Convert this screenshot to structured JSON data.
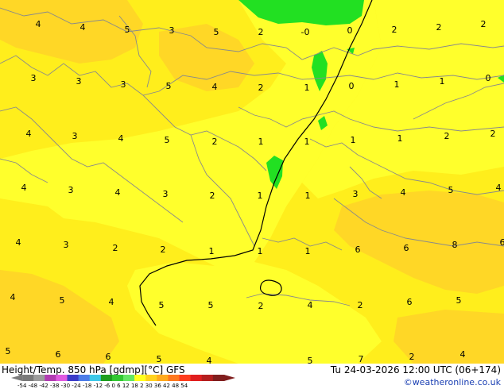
{
  "footer": {
    "title": "Height/Temp. 850 hPa [gdmp][°C] GFS",
    "valid": "Tu 24-03-2026 12:00 UTC (06+174)",
    "credit": "©weatheronline.co.uk",
    "scale_labels": "-54 -48 -42 -38 -30 -24 -18 -12 -6   0   6  12  18  2   30  36  42  48  54",
    "scale_colors": [
      "#7a7a7a",
      "#9c9c9c",
      "#b23cb2",
      "#e05ae0",
      "#3c3cc8",
      "#4c7ce8",
      "#3cc8e8",
      "#1e9e1e",
      "#32c832",
      "#64e664",
      "#ffff1e",
      "#ffd21e",
      "#ffaa1e",
      "#ff781e",
      "#ff3c1e",
      "#e01e1e",
      "#b41e1e",
      "#801e1e"
    ]
  },
  "map": {
    "colors": {
      "warm_yellow": "#fff01e",
      "light_yellow": "#ffff2c",
      "orange_yellow": "#ffd726",
      "green": "#22e022",
      "coast": "#8a8a8a",
      "isotherm": "#000000"
    },
    "labels": [
      {
        "text": "4"
      },
      {
        "text": "4"
      },
      {
        "text": "5"
      },
      {
        "text": "3"
      },
      {
        "text": "5"
      },
      {
        "text": "2"
      },
      {
        "text": "-0"
      },
      {
        "text": "0"
      },
      {
        "text": "2"
      },
      {
        "text": "2"
      },
      {
        "text": "2"
      },
      {
        "text": "3"
      },
      {
        "text": "3"
      },
      {
        "text": "3"
      },
      {
        "text": "5"
      },
      {
        "text": "4"
      },
      {
        "text": "2"
      },
      {
        "text": "1"
      },
      {
        "text": "0"
      },
      {
        "text": "1"
      },
      {
        "text": "1"
      },
      {
        "text": "0"
      },
      {
        "text": "4"
      },
      {
        "text": "3"
      },
      {
        "text": "4"
      },
      {
        "text": "5"
      },
      {
        "text": "2"
      },
      {
        "text": "1"
      },
      {
        "text": "1"
      },
      {
        "text": "1"
      },
      {
        "text": "1"
      },
      {
        "text": "2"
      },
      {
        "text": "2"
      },
      {
        "text": "4"
      },
      {
        "text": "3"
      },
      {
        "text": "4"
      },
      {
        "text": "3"
      },
      {
        "text": "2"
      },
      {
        "text": "1"
      },
      {
        "text": "1"
      },
      {
        "text": "3"
      },
      {
        "text": "4"
      },
      {
        "text": "5"
      },
      {
        "text": "4"
      },
      {
        "text": "4"
      },
      {
        "text": "3"
      },
      {
        "text": "2"
      },
      {
        "text": "2"
      },
      {
        "text": "1"
      },
      {
        "text": "1"
      },
      {
        "text": "1"
      },
      {
        "text": "6"
      },
      {
        "text": "6"
      },
      {
        "text": "8"
      },
      {
        "text": "6"
      },
      {
        "text": "4"
      },
      {
        "text": "5"
      },
      {
        "text": "4"
      },
      {
        "text": "5"
      },
      {
        "text": "5"
      },
      {
        "text": "2"
      },
      {
        "text": "4"
      },
      {
        "text": "2"
      },
      {
        "text": "6"
      },
      {
        "text": "5"
      },
      {
        "text": "5"
      },
      {
        "text": "6"
      },
      {
        "text": "6"
      },
      {
        "text": "5"
      },
      {
        "text": "4"
      },
      {
        "text": "5"
      },
      {
        "text": "7"
      },
      {
        "text": "2"
      },
      {
        "text": "4"
      }
    ]
  }
}
